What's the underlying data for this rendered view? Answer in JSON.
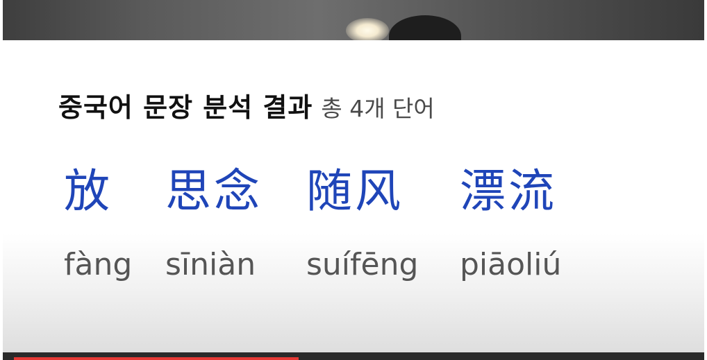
{
  "header": {
    "title": "중국어 문장 분석 결과",
    "count": "총 4개 단어"
  },
  "words": [
    {
      "hanzi": "放",
      "pinyin": "fàng"
    },
    {
      "hanzi": "思念",
      "pinyin": "sīniàn"
    },
    {
      "hanzi": "随风",
      "pinyin": "suífēng"
    },
    {
      "hanzi": "漂流",
      "pinyin": "piāoliú"
    }
  ],
  "colors": {
    "hanzi": "#1f45b8",
    "pinyin": "#555555",
    "title": "#111111",
    "progress": "#e53935"
  }
}
